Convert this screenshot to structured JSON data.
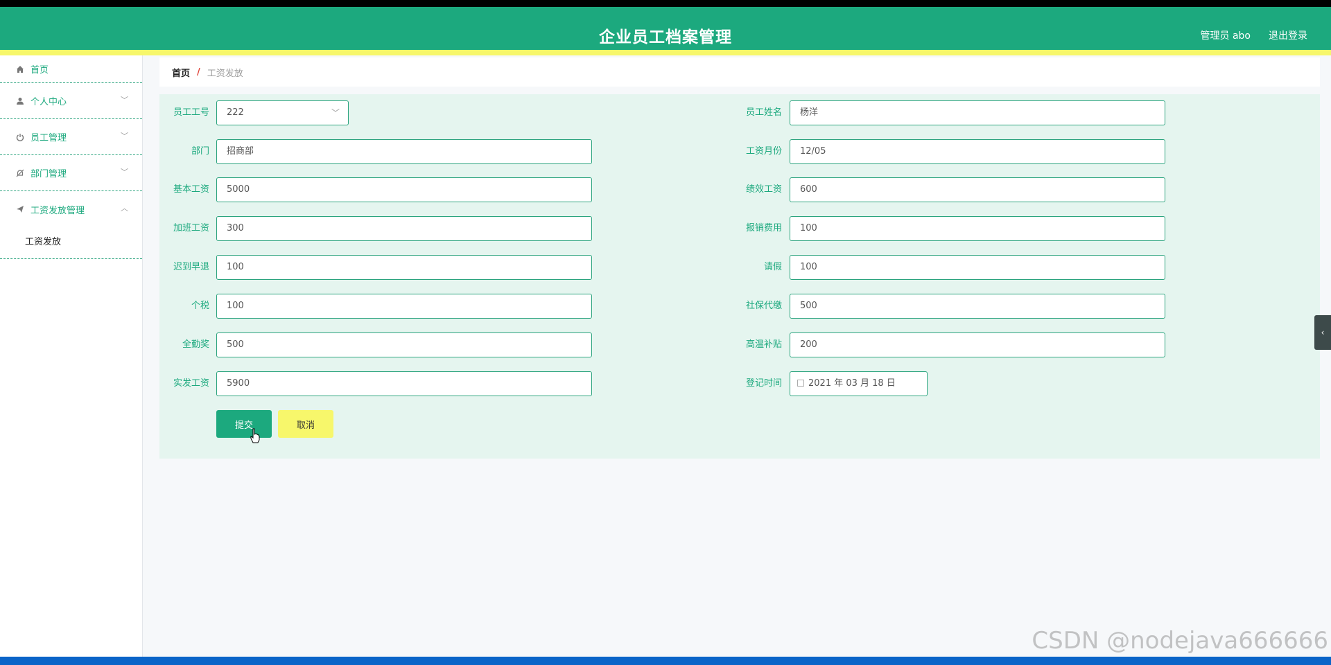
{
  "header": {
    "title": "企业员工档案管理",
    "admin": "管理员 abo",
    "logout": "退出登录"
  },
  "sidebar": {
    "home": "首页",
    "items": [
      {
        "label": "个人中心",
        "icon": "user-icon"
      },
      {
        "label": "员工管理",
        "icon": "power-icon"
      },
      {
        "label": "部门管理",
        "icon": "bell-icon"
      },
      {
        "label": "工资发放管理",
        "icon": "send-icon"
      }
    ],
    "sub_item": "工资发放"
  },
  "breadcrumb": {
    "home": "首页",
    "separator": "/",
    "current": "工资发放"
  },
  "form": {
    "employee_no": {
      "label": "员工工号",
      "value": "222"
    },
    "employee_name": {
      "label": "员工姓名",
      "value": "杨洋"
    },
    "department": {
      "label": "部门",
      "value": "招商部"
    },
    "salary_month": {
      "label": "工资月份",
      "value": "12/05"
    },
    "base_salary": {
      "label": "基本工资",
      "value": "5000"
    },
    "performance_pay": {
      "label": "绩效工资",
      "value": "600"
    },
    "overtime_pay": {
      "label": "加班工资",
      "value": "300"
    },
    "reimbursement": {
      "label": "报销费用",
      "value": "100"
    },
    "late_early": {
      "label": "迟到早退",
      "value": "100"
    },
    "leave": {
      "label": "请假",
      "value": "100"
    },
    "income_tax": {
      "label": "个税",
      "value": "100"
    },
    "social_insurance": {
      "label": "社保代缴",
      "value": "500"
    },
    "attendance_bonus": {
      "label": "全勤奖",
      "value": "500"
    },
    "heat_allowance": {
      "label": "高温补贴",
      "value": "200"
    },
    "net_salary": {
      "label": "实发工资",
      "value": "5900"
    },
    "register_time": {
      "label": "登记时间",
      "value": "2021 年 03 月 18 日"
    }
  },
  "buttons": {
    "submit": "提交",
    "cancel": "取消"
  },
  "watermark": "CSDN @nodejava666666",
  "colors": {
    "primary": "#1ca97e",
    "accent_yellow": "#f7f76b",
    "panel_bg": "#e5f5ef"
  }
}
